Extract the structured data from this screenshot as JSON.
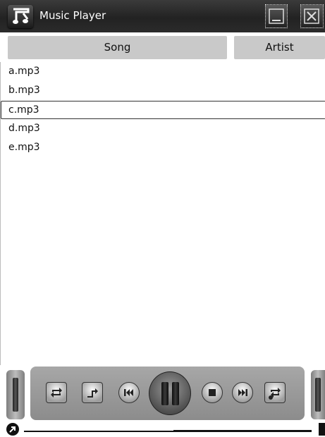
{
  "window": {
    "title": "Music Player"
  },
  "columns": {
    "song": "Song",
    "artist": "Artist"
  },
  "songs": [
    "a.mp3",
    "b.mp3",
    "c.mp3",
    "d.mp3",
    "e.mp3"
  ],
  "selected_index": 2,
  "progress": 0.52,
  "colors": {
    "titlebar": "#2a2a2a",
    "header_bg": "#c9c9c9",
    "control_panel": "#9a9a9a"
  }
}
